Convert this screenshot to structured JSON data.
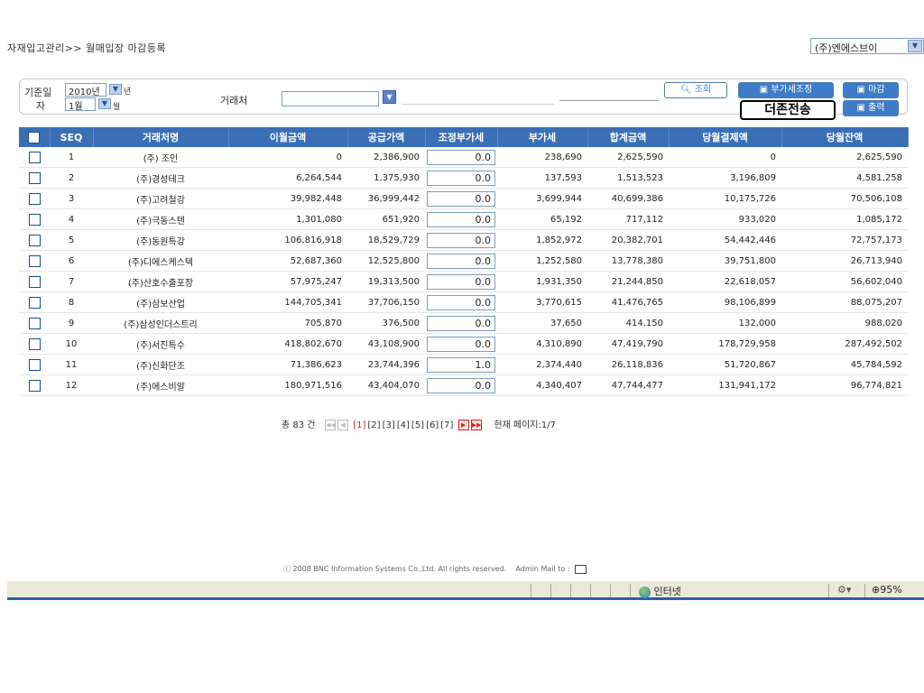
{
  "breadcrumb": "자재입고관리>> 월매입장 마감등록",
  "company_select": "(주)엔에스브이",
  "filter": {
    "date_label_1": "기준일",
    "date_label_2": "자",
    "year": "2010년",
    "year_unit": "년",
    "month": "1월",
    "month_unit": "월",
    "partner_label": "거래처",
    "partner_value": ""
  },
  "toolbar": {
    "search": "조회",
    "vat_adjust": "부가세조정",
    "close": "마감",
    "print": "출력",
    "send": "더존전송"
  },
  "table": {
    "headers": [
      "SEQ",
      "거래처명",
      "이월금액",
      "공급가액",
      "조정부가세",
      "부가세",
      "합계금액",
      "당월결제액",
      "당월잔액"
    ],
    "rows": [
      {
        "seq": "1",
        "name": "(주) 조인",
        "carry": "0",
        "supply": "2,386,900",
        "adj": "0.0",
        "vat": "238,690",
        "total": "2,625,590",
        "paid": "0",
        "balance": "2,625,590"
      },
      {
        "seq": "2",
        "name": "(주)경성테크",
        "carry": "6,264,544",
        "supply": "1,375,930",
        "adj": "0.0",
        "vat": "137,593",
        "total": "1,513,523",
        "paid": "3,196,809",
        "balance": "4,581,258"
      },
      {
        "seq": "3",
        "name": "(주)고려철강",
        "carry": "39,982,448",
        "supply": "36,999,442",
        "adj": "0.0",
        "vat": "3,699,944",
        "total": "40,699,386",
        "paid": "10,175,726",
        "balance": "70,506,108"
      },
      {
        "seq": "4",
        "name": "(주)극동스텐",
        "carry": "1,301,080",
        "supply": "651,920",
        "adj": "0.0",
        "vat": "65,192",
        "total": "717,112",
        "paid": "933,020",
        "balance": "1,085,172"
      },
      {
        "seq": "5",
        "name": "(주)동원특강",
        "carry": "106,816,918",
        "supply": "18,529,729",
        "adj": "0.0",
        "vat": "1,852,972",
        "total": "20,382,701",
        "paid": "54,442,446",
        "balance": "72,757,173"
      },
      {
        "seq": "6",
        "name": "(주)디에스케스텍",
        "carry": "52,687,360",
        "supply": "12,525,800",
        "adj": "0.0",
        "vat": "1,252,580",
        "total": "13,778,380",
        "paid": "39,751,800",
        "balance": "26,713,940"
      },
      {
        "seq": "7",
        "name": "(주)산호수출포장",
        "carry": "57,975,247",
        "supply": "19,313,500",
        "adj": "0.0",
        "vat": "1,931,350",
        "total": "21,244,850",
        "paid": "22,618,057",
        "balance": "56,602,040"
      },
      {
        "seq": "8",
        "name": "(주)삼보산업",
        "carry": "144,705,341",
        "supply": "37,706,150",
        "adj": "0.0",
        "vat": "3,770,615",
        "total": "41,476,765",
        "paid": "98,106,899",
        "balance": "88,075,207"
      },
      {
        "seq": "9",
        "name": "(주)삼성인더스트리",
        "carry": "705,870",
        "supply": "376,500",
        "adj": "0.0",
        "vat": "37,650",
        "total": "414,150",
        "paid": "132,000",
        "balance": "988,020"
      },
      {
        "seq": "10",
        "name": "(주)서진특수",
        "carry": "418,802,670",
        "supply": "43,108,900",
        "adj": "0.0",
        "vat": "4,310,890",
        "total": "47,419,790",
        "paid": "178,729,958",
        "balance": "287,492,502"
      },
      {
        "seq": "11",
        "name": "(주)신화단조",
        "carry": "71,386,623",
        "supply": "23,744,396",
        "adj": "1.0",
        "vat": "2,374,440",
        "total": "26,118,836",
        "paid": "51,720,867",
        "balance": "45,784,592"
      },
      {
        "seq": "12",
        "name": "(주)에스비알",
        "carry": "180,971,516",
        "supply": "43,404,070",
        "adj": "0.0",
        "vat": "4,340,407",
        "total": "47,744,477",
        "paid": "131,941,172",
        "balance": "96,774,821"
      }
    ]
  },
  "paging": {
    "total": "총 83 건",
    "pages": [
      "[1]",
      "[2]",
      "[3]",
      "[4]",
      "[5]",
      "[6]",
      "[7]"
    ],
    "current": "현재 페이지:1/7"
  },
  "footer": {
    "copyright": "ⓒ 2008 BNC Information Systems Co.,Ltd. All rights reserved.",
    "admin_mail": "Admin Mail to :"
  },
  "statusbar": {
    "zone": "인터넷",
    "zoom": "95%"
  },
  "colors": {
    "header_bg": "#3a6fb6",
    "button_blue": "#3d7cc7",
    "current_page": "#dd2222"
  }
}
